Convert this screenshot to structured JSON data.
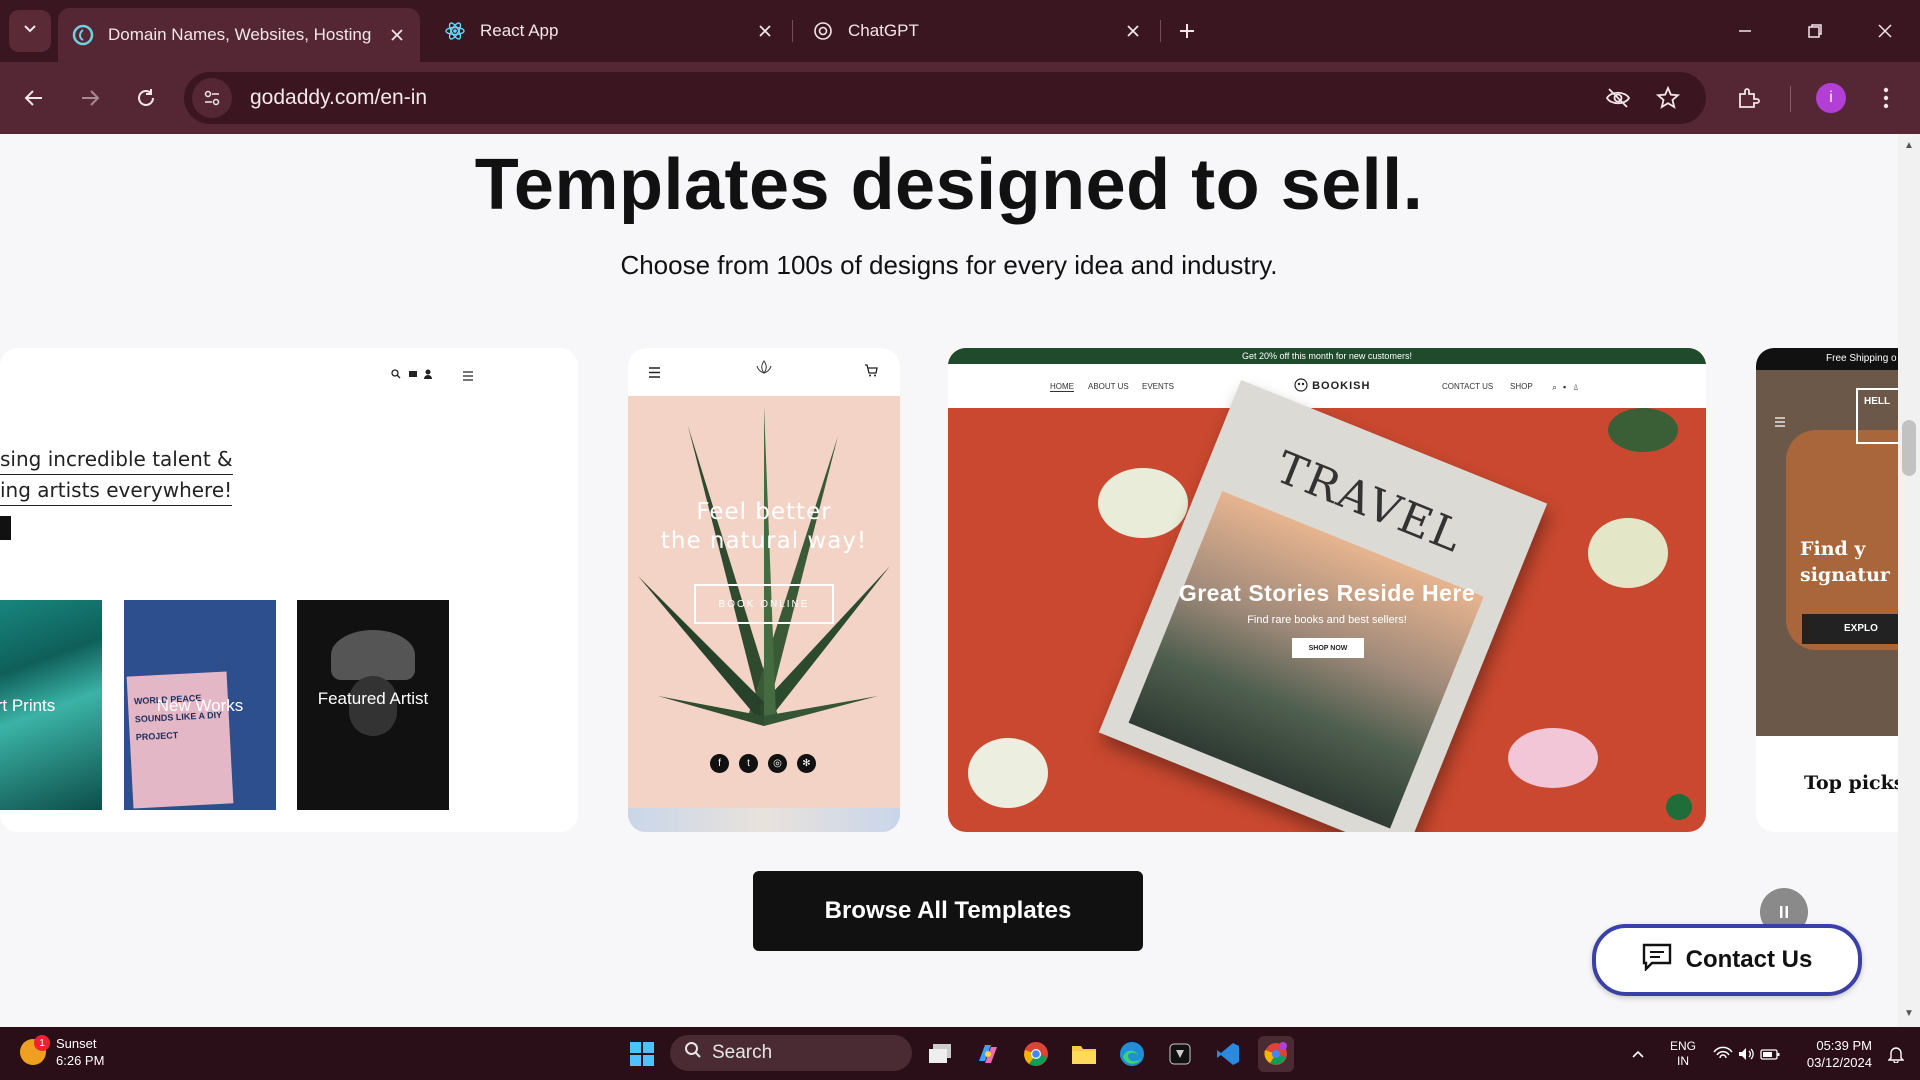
{
  "browser": {
    "tabs": [
      {
        "title": "Domain Names, Websites, Hosting",
        "active": true
      },
      {
        "title": "React App",
        "active": false
      },
      {
        "title": "ChatGPT",
        "active": false
      }
    ],
    "url": "godaddy.com/en-in",
    "profile_initial": "i"
  },
  "page": {
    "headline": "Templates designed to sell.",
    "subheadline": "Choose from 100s of designs for every idea and industry.",
    "templates": {
      "artist": {
        "tagline_line1": "sing incredible talent &",
        "tagline_line2": "ing artists everywhere!",
        "thumbs": [
          "rt Prints",
          "New Works",
          "Featured Artist"
        ],
        "poster_text": "WORLD PEACE SOUNDS LIKE A DIY PROJECT"
      },
      "plant": {
        "hero_line1": "Feel better",
        "hero_line2": "the natural way!",
        "button": "BOOK ONLINE"
      },
      "bookish": {
        "promo": "Get 20% off this month for new customers!",
        "nav_left": [
          "HOME",
          "ABOUT US",
          "EVENTS"
        ],
        "brand": "BOOKISH",
        "nav_right": [
          "CONTACT US",
          "SHOP"
        ],
        "book_title": "TRAVEL",
        "hero_title": "Great Stories Reside Here",
        "hero_sub": "Find rare books and best sellers!",
        "cta": "SHOP NOW"
      },
      "furniture": {
        "promo": "Free Shipping o",
        "hello": "HELL",
        "hero_line1": "Find y",
        "hero_line2": "signatur",
        "explore": "EXPLO",
        "top_picks": "Top picks"
      }
    },
    "browse_button": "Browse All Templates",
    "contact_button": "Contact Us"
  },
  "taskbar": {
    "weather_title": "Sunset",
    "weather_time": "6:26 PM",
    "weather_badge": "1",
    "search_placeholder": "Search",
    "lang_line1": "ENG",
    "lang_line2": "IN",
    "time": "05:39 PM",
    "date": "03/12/2024"
  },
  "colors": {
    "tabbar": "#3a1620",
    "toolbar": "#552734",
    "contact_border": "#3b3fa8",
    "bookish_green": "#1f4a2c"
  }
}
